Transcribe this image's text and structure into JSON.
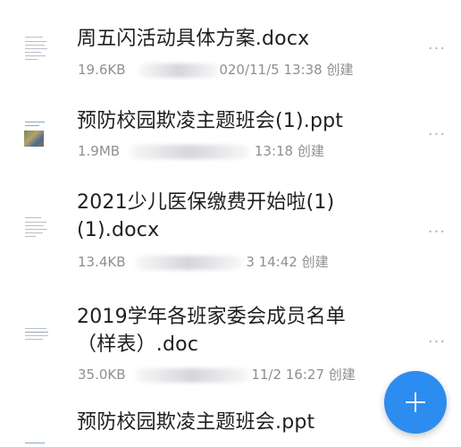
{
  "files": [
    {
      "name": "周五闪活动具体方案.docx",
      "size": "19.6KB",
      "date_partial": "020/11/5 13:38",
      "action": "创建",
      "thumb": "doc-thumbnail-icon"
    },
    {
      "name": "预防校园欺凌主题班会(1).ppt",
      "size": "1.9MB",
      "date_partial": "13:18",
      "action": "创建",
      "thumb": "ppt-thumbnail-icon"
    },
    {
      "name": "2021少儿医保缴费开始啦(1)(1).docx",
      "size": "13.4KB",
      "date_partial": "3 14:42",
      "action": "创建",
      "thumb": "doc-thumbnail-icon"
    },
    {
      "name": "2019学年各班家委会成员名单（样表）.doc",
      "size": "35.0KB",
      "date_partial": "11/2 16:27",
      "action": "创建",
      "thumb": "doc-thumbnail-icon"
    },
    {
      "name": "预防校园欺凌主题班会.ppt",
      "thumb": "ppt-thumbnail-icon"
    }
  ],
  "more_icon": "more-horizontal-icon",
  "more_glyph": "···",
  "fab": {
    "icon": "plus-icon",
    "color": "#2d8cf0"
  }
}
